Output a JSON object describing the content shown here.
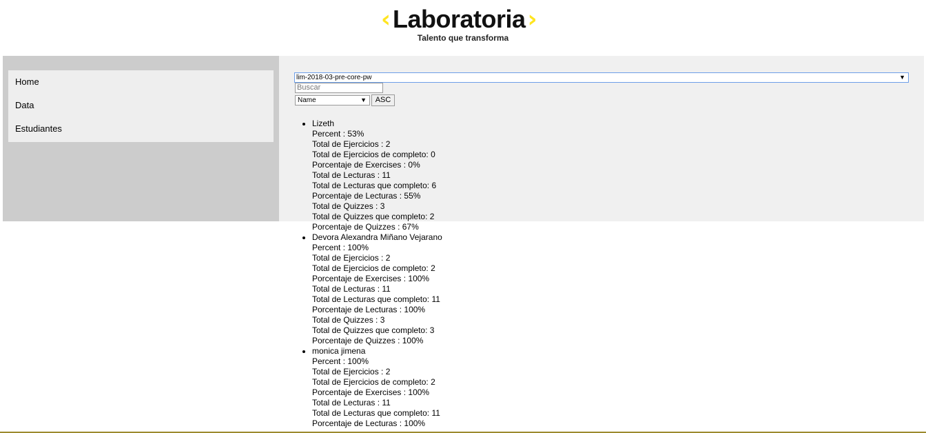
{
  "header": {
    "brand": "Laboratoria",
    "bracket_left": "‹",
    "bracket_right": "›",
    "tagline": "Talento que transforma",
    "accent_color": "#ffe521"
  },
  "sidebar": {
    "items": [
      {
        "label": "Home"
      },
      {
        "label": "Data"
      },
      {
        "label": "Estudiantes"
      }
    ]
  },
  "filters": {
    "cohort_selected": "lim-2018-03-pre-core-pw",
    "search_placeholder": "Buscar",
    "sort_selected": "Name",
    "order_label": "ASC"
  },
  "students": [
    {
      "name": "Lizeth",
      "lines": [
        "Percent : 53%",
        "Total de Ejercicios : 2",
        "Total de Ejercicios de completo: 0",
        "Porcentaje de Exercises : 0%",
        "Total de Lecturas : 11",
        "Total de Lecturas que completo: 6",
        "Porcentaje de Lecturas : 55%",
        "Total de Quizzes : 3",
        "Total de Quizzes que completo: 2",
        "Porcentaje de Quizzes : 67%"
      ]
    },
    {
      "name": "Devora Alexandra Miñano Vejarano",
      "lines": [
        "Percent : 100%",
        "Total de Ejercicios : 2",
        "Total de Ejercicios de completo: 2",
        "Porcentaje de Exercises : 100%",
        "Total de Lecturas : 11",
        "Total de Lecturas que completo: 11",
        "Porcentaje de Lecturas : 100%",
        "Total de Quizzes : 3",
        "Total de Quizzes que completo: 3",
        "Porcentaje de Quizzes : 100%"
      ]
    },
    {
      "name": "monica jimena",
      "lines": [
        "Percent : 100%",
        "Total de Ejercicios : 2",
        "Total de Ejercicios de completo: 2",
        "Porcentaje de Exercises : 100%",
        "Total de Lecturas : 11",
        "Total de Lecturas que completo: 11",
        "Porcentaje de Lecturas : 100%"
      ]
    }
  ]
}
